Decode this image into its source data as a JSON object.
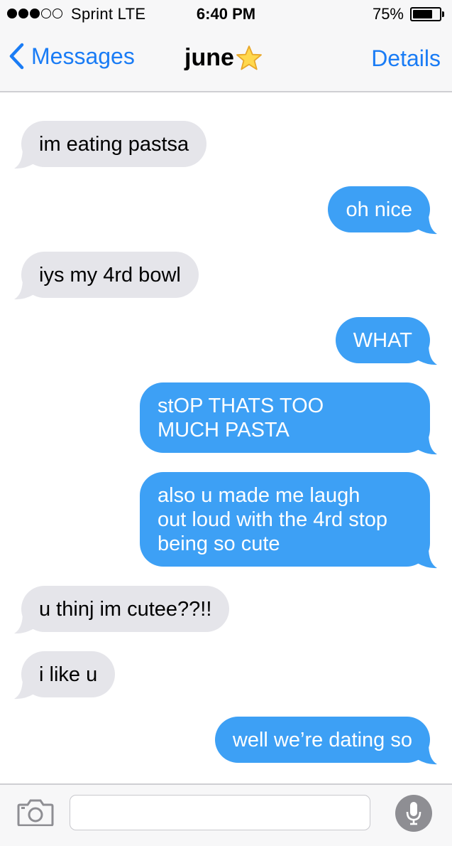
{
  "status_bar": {
    "carrier": "Sprint  LTE",
    "time": "6:40 PM",
    "battery": "75%",
    "battery_level": 0.75,
    "signal_bars_filled": 3,
    "signal_bars_total": 5
  },
  "nav": {
    "back_label": "Messages",
    "title": "june",
    "title_emoji": "star",
    "details_label": "Details"
  },
  "messages": [
    {
      "direction": "incoming",
      "text": "im eating pastsa"
    },
    {
      "direction": "outgoing",
      "text": "oh nice"
    },
    {
      "direction": "incoming",
      "text": "iys my 4rd bowl"
    },
    {
      "direction": "outgoing",
      "text": "WHAT"
    },
    {
      "direction": "outgoing",
      "text": "stOP THATS TOO\nMUCH PASTA"
    },
    {
      "direction": "outgoing",
      "text": "also u made me laugh\nout loud with the 4rd stop\nbeing so cute"
    },
    {
      "direction": "incoming",
      "text": "u thinj im cutee??!!"
    },
    {
      "direction": "incoming",
      "text": "i like u"
    },
    {
      "direction": "outgoing",
      "text": "well we’re dating so"
    }
  ],
  "input_bar": {
    "camera_icon": "camera-icon",
    "text_value": "",
    "mic_icon": "microphone-icon"
  },
  "colors": {
    "accent": "#1a7cf5",
    "outgoing_bubble": "#3da0f5",
    "incoming_bubble": "#e5e5ea"
  }
}
